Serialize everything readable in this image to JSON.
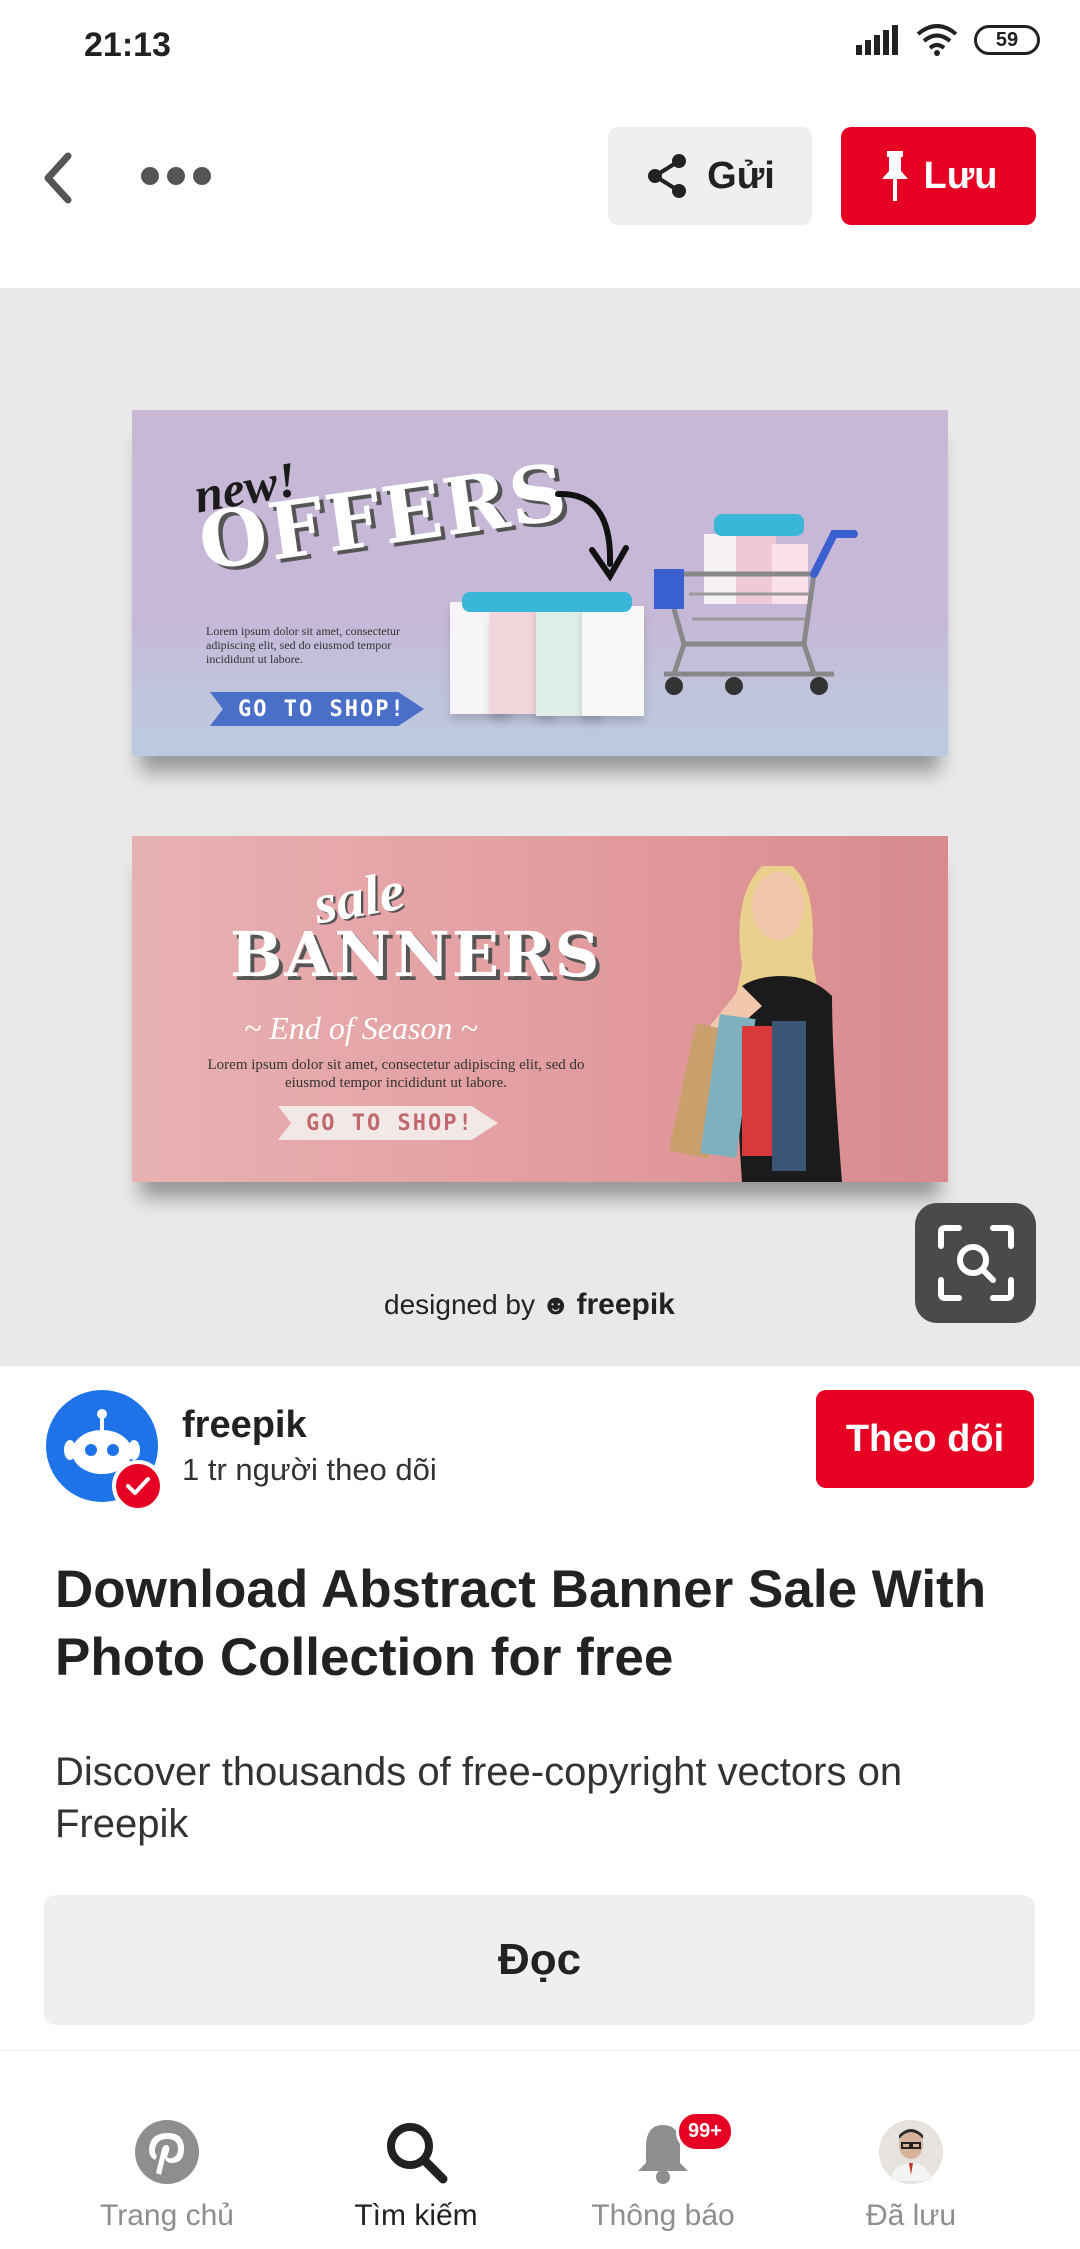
{
  "status_bar": {
    "time": "21:13",
    "battery": "59"
  },
  "header": {
    "send_label": "Gửi",
    "save_label": "Lưu"
  },
  "image": {
    "banner1": {
      "small_text": "new!",
      "big_text": "OFFERS",
      "lorem": "Lorem ipsum dolor sit amet, consectetur adipiscing elit, sed do eiusmod tempor incididunt ut labore.",
      "cta": "GO TO SHOP!"
    },
    "banner2": {
      "small_text": "sale",
      "big_text": "BANNERS",
      "subtitle": "~ End of Season ~",
      "lorem": "Lorem ipsum dolor sit amet, consectetur adipiscing elit, sed do eiusmod tempor incididunt ut labore.",
      "cta": "GO TO SHOP!"
    },
    "credit_prefix": "designed by",
    "credit_brand": "freepik"
  },
  "creator": {
    "name": "freepik",
    "followers": "1 tr người theo dõi",
    "follow_label": "Theo dõi"
  },
  "pin": {
    "title": "Download Abstract Banner Sale With Photo Collection for free",
    "description": "Discover thousands of free-copyright vectors on Freepik",
    "read_label": "Đọc"
  },
  "bottom_nav": {
    "items": [
      {
        "label": "Trang chủ",
        "icon": "pinterest-icon"
      },
      {
        "label": "Tìm kiếm",
        "icon": "search-icon"
      },
      {
        "label": "Thông báo",
        "icon": "bell-icon",
        "badge": "99+"
      },
      {
        "label": "Đã lưu",
        "icon": "avatar"
      }
    ]
  },
  "colors": {
    "accent": "#e60023",
    "secondary_button": "#efefef",
    "image_bg": "#e9e9ea"
  }
}
